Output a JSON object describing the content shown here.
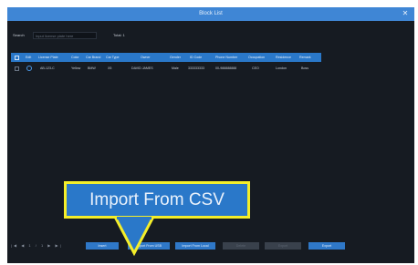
{
  "window": {
    "title": "Block List",
    "close_icon": "close-icon"
  },
  "search": {
    "label": "Search",
    "placeholder": "Input license plate here",
    "total_label": "Total: 1"
  },
  "table": {
    "headers": [
      "Edit",
      "License Plate",
      "Color",
      "Car Brand",
      "Car Type",
      "Owner",
      "Gender",
      "ID Code",
      "Phone Number",
      "Occupation",
      "Residence",
      "Remark"
    ],
    "rows": [
      [
        "AB-123-C",
        "Yellow",
        "BMW",
        "X5",
        "DAVID JAMES",
        "Male",
        "333333333",
        "00-988888888",
        "CEO",
        "London",
        "Boss"
      ]
    ]
  },
  "footer": {
    "pager": "|◀  ◀  1 / 1  ▶  ▶|",
    "buttons": [
      {
        "label": "Insert",
        "enabled": true
      },
      {
        "label": "Import From USB",
        "enabled": true
      },
      {
        "label": "Import From Local",
        "enabled": true
      },
      {
        "label": "Delete",
        "enabled": false
      },
      {
        "label": "Export",
        "enabled": false
      },
      {
        "label": "Export",
        "enabled": true
      }
    ]
  },
  "callout": {
    "text": "Import From CSV",
    "border_color": "#f4ee2a"
  },
  "colors": {
    "title_bar": "#3f86d5",
    "header": "#2a78c9",
    "background": "#161b22",
    "button": "#2f78c8"
  }
}
